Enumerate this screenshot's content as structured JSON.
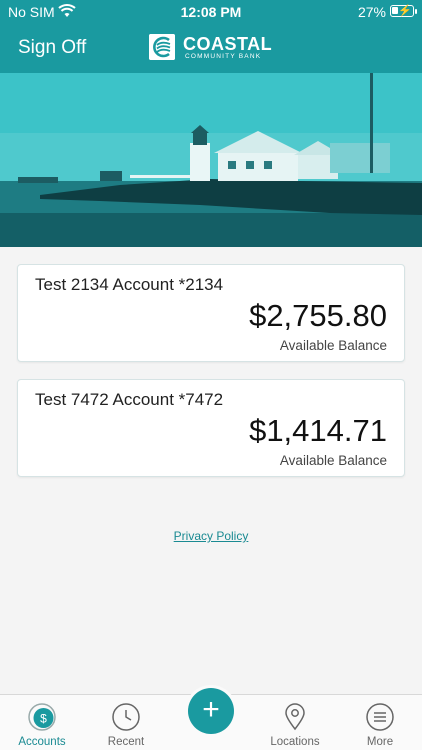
{
  "status_bar": {
    "carrier": "No SIM",
    "time": "12:08 PM",
    "battery": "27%"
  },
  "header": {
    "sign_off": "Sign Off",
    "logo_name": "COASTAL",
    "logo_sub": "COMMUNITY BANK"
  },
  "accounts": [
    {
      "name": "Test 2134 Account *2134",
      "balance": "$2,755.80",
      "balance_label": "Available Balance"
    },
    {
      "name": "Test 7472 Account *7472",
      "balance": "$1,414.71",
      "balance_label": "Available Balance"
    }
  ],
  "privacy_link": "Privacy Policy",
  "tabs": [
    {
      "label": "Accounts",
      "icon": "dollar-icon",
      "active": true
    },
    {
      "label": "Recent",
      "icon": "clock-icon",
      "active": false
    },
    {
      "label": "Locations",
      "icon": "map-pin-icon",
      "active": false
    },
    {
      "label": "More",
      "icon": "menu-icon",
      "active": false
    }
  ],
  "colors": {
    "brand": "#1a9aa0",
    "link": "#1a8a92"
  }
}
